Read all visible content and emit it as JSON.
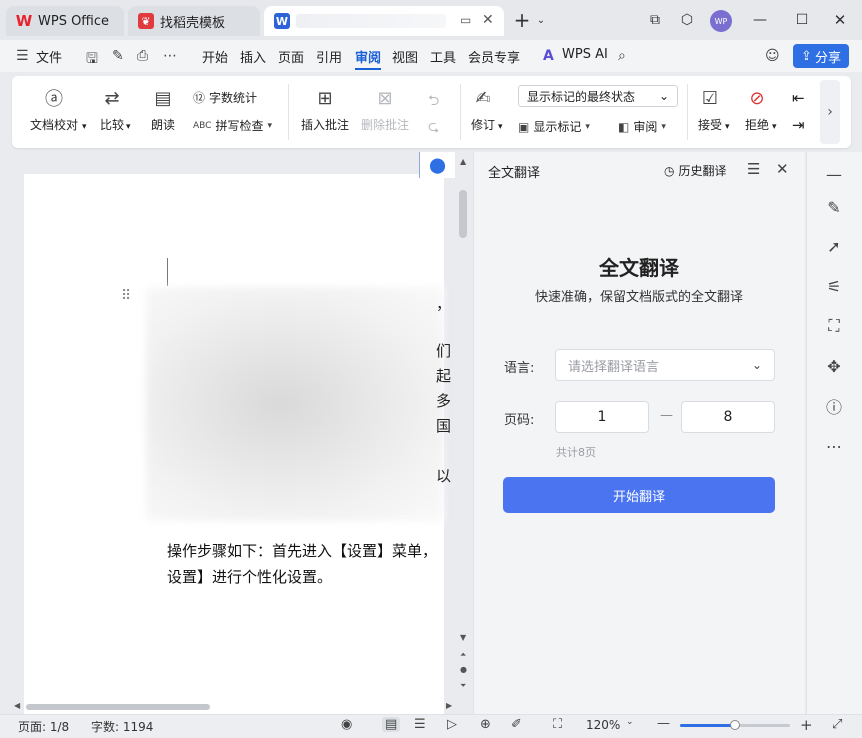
{
  "titlebar": {
    "tabs": [
      {
        "label": "WPS Office",
        "icon": "wps-logo-icon"
      },
      {
        "label": "找稻壳模板",
        "icon": "docer-logo-icon"
      },
      {
        "label": "",
        "icon": "writer-doc-icon"
      }
    ],
    "new_tab": "+",
    "avatar_initials": "WP"
  },
  "menubar": {
    "file_label": "文件",
    "items": [
      "开始",
      "插入",
      "页面",
      "引用",
      "审阅",
      "视图",
      "工具",
      "会员专享"
    ],
    "active": "审阅",
    "wps_ai_label": "WPS AI",
    "share_label": "分享"
  },
  "ribbon": {
    "proofread": "文档校对",
    "compare": "比较",
    "read_aloud": "朗读",
    "word_count": "字数统计",
    "spell_check": "拼写检查",
    "insert_comment": "插入批注",
    "delete_comment": "删除批注",
    "track_changes": "修订",
    "markup_state": "显示标记的最终状态",
    "show_markup": "显示标记",
    "review": "审阅",
    "accept": "接受",
    "reject": "拒绝"
  },
  "document": {
    "edge_chars": [
      "，",
      "们",
      "起",
      "多",
      "国",
      "以"
    ],
    "lines": [
      "操作步骤如下：首先进入【设置】菜单，",
      "设置】进行个性化设置。"
    ]
  },
  "panel": {
    "header": "全文翻译",
    "history_label": "历史翻译",
    "title": "全文翻译",
    "subtitle": "快速准确，保留文档版式的全文翻译",
    "language_label": "语言:",
    "language_placeholder": "请选择翻译语言",
    "page_label": "页码:",
    "page_from": "1",
    "page_dash": "—",
    "page_to": "8",
    "page_total": "共计8页",
    "start_button": "开始翻译"
  },
  "statusbar": {
    "page": "页面: 1/8",
    "word_count": "字数: 1194",
    "zoom": "120%",
    "zoom_level": 0.5
  },
  "colors": {
    "accent": "#2f6fe4",
    "start_button": "#4a74f0",
    "wps_red": "#e8232e"
  }
}
